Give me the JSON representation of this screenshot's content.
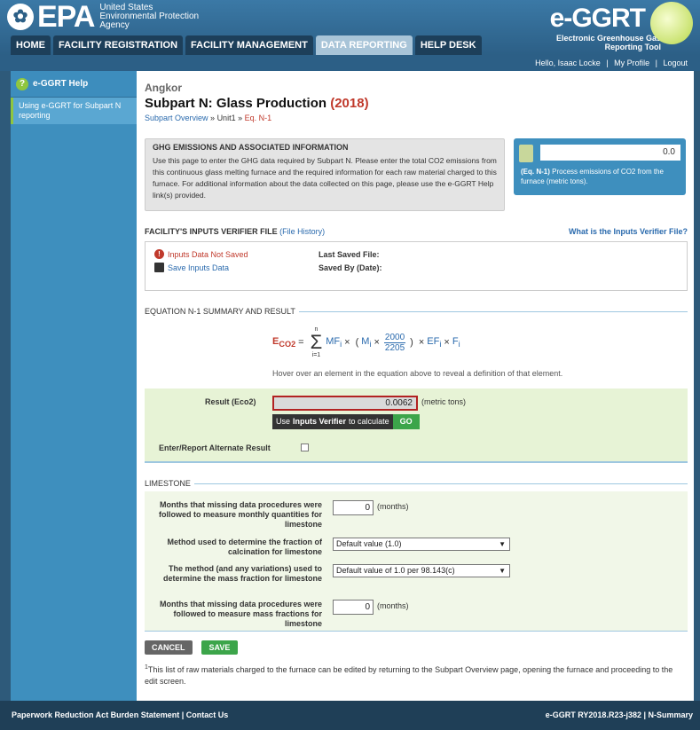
{
  "header": {
    "epa_word": "EPA",
    "agency": [
      "United States",
      "Environmental Protection",
      "Agency"
    ],
    "eggrt_title": "e-GGRT",
    "eggrt_sub": [
      "Electronic Greenhouse Gas",
      "Reporting Tool"
    ]
  },
  "nav": [
    "HOME",
    "FACILITY REGISTRATION",
    "FACILITY MANAGEMENT",
    "DATA REPORTING",
    "HELP DESK"
  ],
  "userbar": {
    "hello": "Hello, Isaac Locke",
    "profile": "My Profile",
    "logout": "Logout"
  },
  "sidebar": {
    "help_title": "e-GGRT Help",
    "help_link": "Using e-GGRT for Subpart N reporting"
  },
  "main": {
    "facility": "Angkor",
    "title": "Subpart N: Glass Production",
    "year": "(2018)",
    "crumb_overview": "Subpart Overview",
    "crumb_unit": "Unit1",
    "crumb_current": "Eq. N-1"
  },
  "info": {
    "heading": "GHG EMISSIONS AND ASSOCIATED INFORMATION",
    "text": "Use this page to enter the GHG data required by Subpart N. Please enter the total CO2 emissions from this continuous glass melting furnace and the required information for each raw material charged to this furnace. For additional information about the data collected on this page, please use the e-GGRT Help link(s) provided."
  },
  "calc": {
    "value": "0.0",
    "desc_bold": "(Eq. N-1)",
    "desc": "Process emissions of CO2 from the furnace (metric tons)."
  },
  "verifier": {
    "heading": "FACILITY'S INPUTS VERIFIER FILE",
    "history": "(File History)",
    "what_link": "What is the Inputs Verifier File?",
    "not_saved": "Inputs Data Not Saved",
    "save_link": "Save Inputs Data",
    "last_saved": "Last Saved File:",
    "saved_by": "Saved By (Date):"
  },
  "equation": {
    "heading": "EQUATION N-1 SUMMARY AND RESULT",
    "e": "E",
    "e_sub": "CO2",
    "sigma_top": "n",
    "sigma_bot": "i=1",
    "mf": "MF",
    "m": "M",
    "num": "2000",
    "den": "2205",
    "ef": "EF",
    "f": "F",
    "sub_i": "i",
    "hint": "Hover over an element in the equation above to reveal a definition of that element."
  },
  "result": {
    "label": "Result (Eco2)",
    "value": "0.0062",
    "unit": "(metric tons)",
    "tip_pre": "Use",
    "tip_bold": "Inputs Verifier",
    "tip_post": "to calculate",
    "go": "GO",
    "alt_label": "Enter/Report Alternate Result"
  },
  "limestone": {
    "heading": "LIMESTONE",
    "rows": [
      {
        "label": "Months that missing data procedures were followed to measure monthly quantities for limestone",
        "value": "0",
        "unit": "(months)"
      },
      {
        "label": "Method used to determine the fraction of calcination for limestone",
        "value": "Default value (1.0)"
      },
      {
        "label": "The method (and any variations) used to determine the mass fraction for limestone",
        "value": "Default value of 1.0 per 98.143(c)"
      },
      {
        "label": "Months that missing data procedures were followed to measure mass fractions for limestone",
        "value": "0",
        "unit": "(months)"
      }
    ]
  },
  "buttons": {
    "cancel": "CANCEL",
    "save": "SAVE"
  },
  "footnote": {
    "mark": "1",
    "text": "This list of raw materials charged to the furnace can be edited by returning to the Subpart Overview page, opening the furnace and proceeding to the edit screen."
  },
  "footer": {
    "left": "Paperwork Reduction Act Burden Statement  |  Contact Us",
    "right": "e-GGRT RY2018.R23-j382  |  N-Summary"
  }
}
